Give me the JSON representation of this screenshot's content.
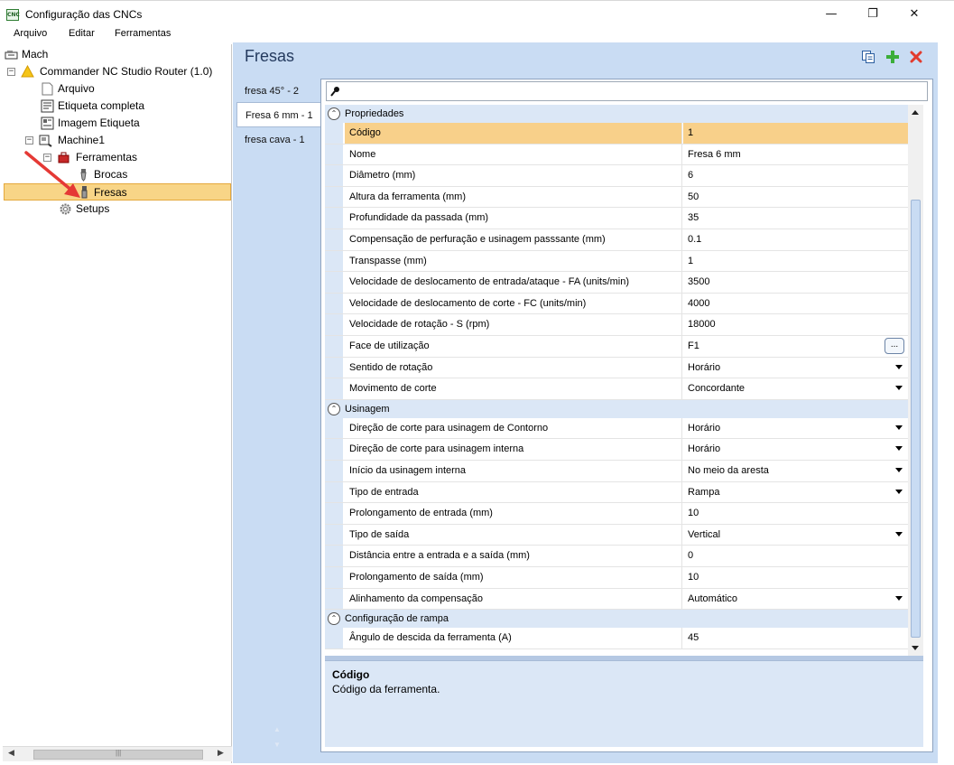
{
  "window": {
    "app_icon_text": "CNC",
    "title": "Configuração das CNCs",
    "minimize": "—",
    "maximize": "❐",
    "close": "✕"
  },
  "menu": [
    "Arquivo",
    "Editar",
    "Ferramentas"
  ],
  "tree": {
    "items": [
      {
        "label": "Mach",
        "icon": "machine-icon"
      },
      {
        "label": "Commander NC Studio Router (1.0)",
        "icon": "warning-icon",
        "expander": "−"
      },
      {
        "label": "Arquivo",
        "icon": "file-icon"
      },
      {
        "label": "Etiqueta completa",
        "icon": "label-icon"
      },
      {
        "label": "Imagem Etiqueta",
        "icon": "image-label-icon"
      },
      {
        "label": "Machine1",
        "icon": "machine-icon",
        "expander": "−"
      },
      {
        "label": "Ferramentas",
        "icon": "tools-icon",
        "expander": "−"
      },
      {
        "label": "Brocas",
        "icon": "drill-icon"
      },
      {
        "label": "Fresas",
        "icon": "mill-icon",
        "selected": true
      },
      {
        "label": "Setups",
        "icon": "gear-icon"
      }
    ],
    "annotation": "red-arrow-icon"
  },
  "panel": {
    "title": "Fresas",
    "toolbar": {
      "copy_icon": "copy-icon",
      "add_icon": "add-icon",
      "delete_icon": "delete-icon"
    },
    "tabs": [
      "fresa 45° - 2",
      "Fresa 6 mm - 1",
      "fresa cava - 1"
    ],
    "active_tab": 1,
    "search": {
      "value": "",
      "icon": "key-icon"
    }
  },
  "grid": {
    "categories": [
      {
        "label": "Propriedades",
        "rows": [
          {
            "name": "Código",
            "value": "1",
            "selected": true
          },
          {
            "name": "Nome",
            "value": "Fresa 6 mm"
          },
          {
            "name": "Diâmetro (mm)",
            "value": "6"
          },
          {
            "name": "Altura da ferramenta (mm)",
            "value": "50"
          },
          {
            "name": "Profundidade da passada (mm)",
            "value": "35"
          },
          {
            "name": "Compensação de perfuração e usinagem passsante (mm)",
            "value": "0.1"
          },
          {
            "name": "Transpasse (mm)",
            "value": "1"
          },
          {
            "name": "Velocidade de deslocamento de entrada/ataque - FA (units/min)",
            "value": "3500"
          },
          {
            "name": "Velocidade de deslocamento de corte - FC (units/min)",
            "value": "4000"
          },
          {
            "name": "Velocidade de rotação - S (rpm)",
            "value": "18000"
          },
          {
            "name": "Face de utilização",
            "value": "F1",
            "editor": "ellipsis"
          },
          {
            "name": "Sentido de rotação",
            "value": "Horário",
            "editor": "dropdown"
          },
          {
            "name": "Movimento de corte",
            "value": "Concordante",
            "editor": "dropdown"
          }
        ]
      },
      {
        "label": "Usinagem",
        "rows": [
          {
            "name": "Direção de corte para usinagem de Contorno",
            "value": "Horário",
            "editor": "dropdown"
          },
          {
            "name": "Direção de corte para usinagem interna",
            "value": "Horário",
            "editor": "dropdown"
          },
          {
            "name": "Início da usinagem interna",
            "value": "No meio da aresta",
            "editor": "dropdown"
          },
          {
            "name": "Tipo de entrada",
            "value": "Rampa",
            "editor": "dropdown"
          },
          {
            "name": "Prolongamento de entrada (mm)",
            "value": "10"
          },
          {
            "name": "Tipo de saída",
            "value": "Vertical",
            "editor": "dropdown"
          },
          {
            "name": "Distância entre a entrada e a saída (mm)",
            "value": "0"
          },
          {
            "name": "Prolongamento de saída (mm)",
            "value": "10"
          },
          {
            "name": "Alinhamento da compensação",
            "value": "Automático",
            "editor": "dropdown"
          }
        ]
      },
      {
        "label": "Configuração de rampa",
        "rows": [
          {
            "name": "Ângulo de descida da ferramenta (A)",
            "value": "45"
          }
        ]
      }
    ],
    "ellipsis_label": "..."
  },
  "description": {
    "title": "Código",
    "text": "Código da ferramenta."
  }
}
